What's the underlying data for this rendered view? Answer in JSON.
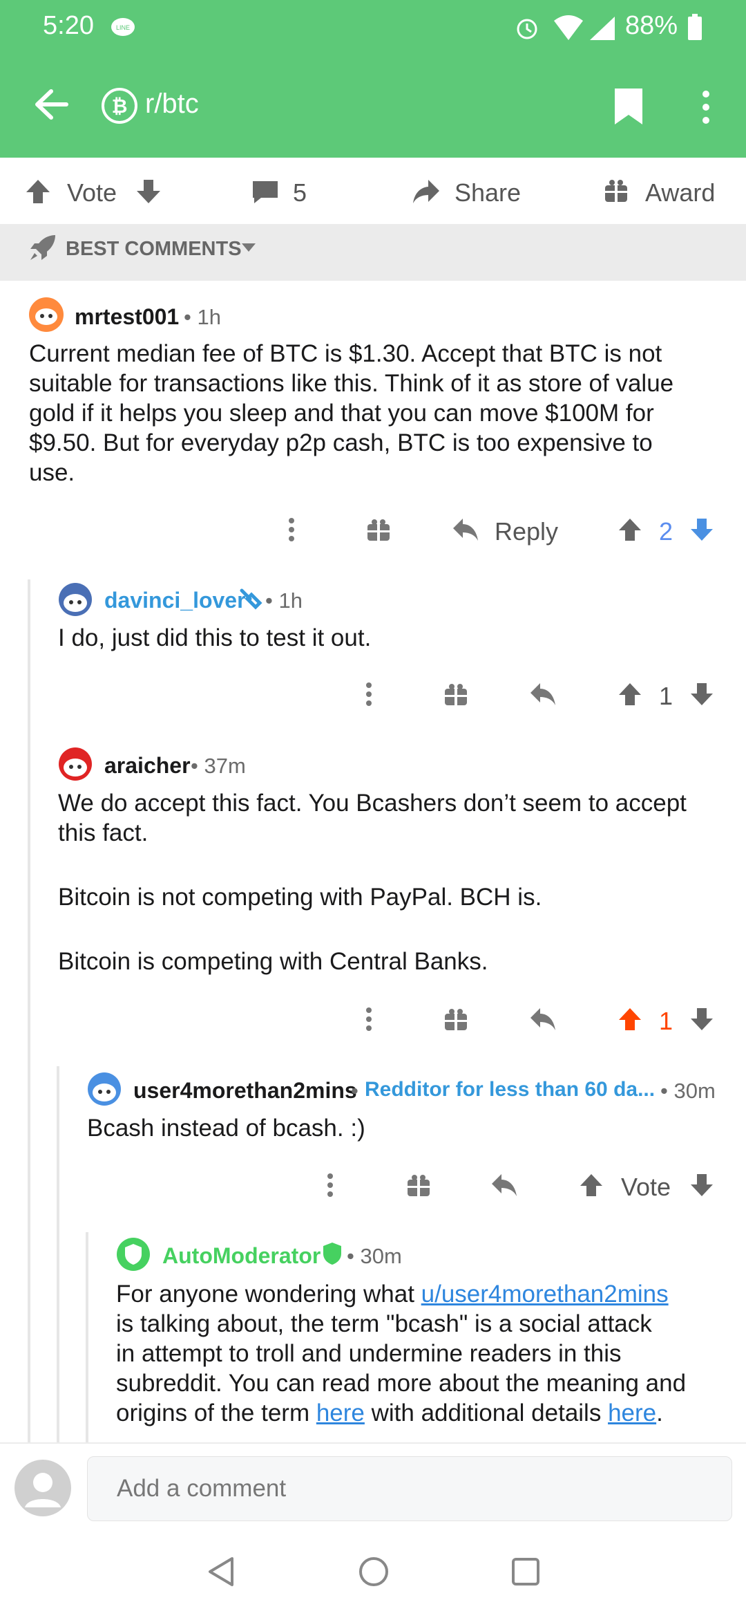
{
  "status_bar": {
    "time": "5:20",
    "battery": "88%"
  },
  "header": {
    "subreddit": "r/btc"
  },
  "action_bar": {
    "vote": "Vote",
    "comments": "5",
    "share": "Share",
    "award": "Award"
  },
  "sort": {
    "label": "BEST COMMENTS"
  },
  "comments": [
    {
      "author": "mrtest001",
      "time": "1h",
      "body": [
        "Current median fee of BTC is $1.30.  Accept that BTC is not",
        "suitable for transactions like this.  Think of it as store of value",
        "gold if it helps you sleep and that you can move $100M for",
        "$9.50.  But for everyday p2p cash, BTC is too expensive to",
        "use."
      ],
      "reply_label": "Reply",
      "score": "2"
    },
    {
      "author": "davinci_lover",
      "time": "1h",
      "body": [
        "I do, just did this to test it out."
      ],
      "score": "1"
    },
    {
      "author": "araicher",
      "time": "37m",
      "body": [
        "We do accept this fact. You Bcashers don’t seem to accept",
        "this fact.",
        "Bitcoin is not competing with PayPal. BCH is.",
        "Bitcoin is competing with Central Banks."
      ],
      "score": "1"
    },
    {
      "author": "user4morethan2mins",
      "flair": "Redditor for less than 60 da...",
      "time": "30m",
      "body": [
        "Bcash instead of bcash.  :)"
      ],
      "score": "Vote"
    },
    {
      "author": "AutoModerator",
      "time": "30m",
      "body_parts": {
        "l1_pre": "For anyone wondering what ",
        "l1_link": "u/user4morethan2mins",
        "l2": "is talking about, the term \"bcash\" is a social attack",
        "l3": "in attempt to troll and undermine readers in this",
        "l4": "subreddit. You can read more about the meaning and",
        "l5_pre": "origins of the term ",
        "l5_link1": "here",
        "l5_mid": " with additional details ",
        "l5_link2": "here",
        "l5_end": "."
      }
    }
  ],
  "comment_bar": {
    "placeholder": "Add a comment"
  },
  "colors": {
    "header": "#5dc978",
    "upvote": "#ff4500",
    "link": "#2e86de",
    "downvote_active": "#4a90e2"
  }
}
